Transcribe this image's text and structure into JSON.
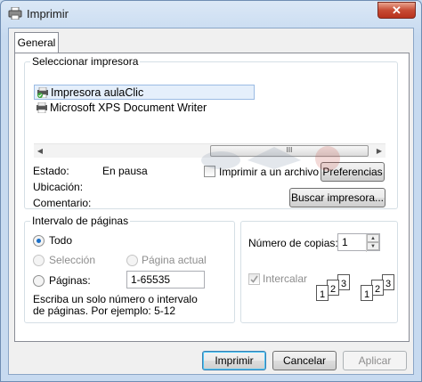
{
  "window": {
    "title": "Imprimir",
    "close_label": "✕"
  },
  "tabs": [
    {
      "label": "General"
    }
  ],
  "printer_group": {
    "legend": "Seleccionar impresora",
    "printers": [
      {
        "name": "Impresora aulaClic",
        "selected": true,
        "default": true
      },
      {
        "name": "Microsoft XPS Document Writer",
        "selected": false,
        "default": false
      }
    ],
    "scroll_thumb_glyph": "III",
    "status_label": "Estado:",
    "status_value": "En pausa",
    "location_label": "Ubicación:",
    "location_value": "",
    "comment_label": "Comentario:",
    "comment_value": "",
    "print_to_file_label": "Imprimir a un archivo",
    "print_to_file_checked": false,
    "preferences_label": "Preferencias",
    "find_printer_label": "Buscar impresora..."
  },
  "range_group": {
    "legend": "Intervalo de páginas",
    "all_label": "Todo",
    "selection_label": "Selección",
    "current_page_label": "Página actual",
    "pages_label": "Páginas:",
    "pages_value": "1-65535",
    "selected_option": "all",
    "hint": "Escriba un solo número o intervalo de páginas. Por ejemplo: 5-12"
  },
  "copies_group": {
    "copies_label": "Número de copias:",
    "copies_value": "1",
    "collate_label": "Intercalar",
    "collate_checked": true,
    "collate_icon": [
      [
        "1",
        "2",
        "3"
      ],
      [
        "1",
        "2",
        "3"
      ]
    ]
  },
  "buttons": {
    "print_label": "Imprimir",
    "cancel_label": "Cancelar",
    "apply_label": "Aplicar"
  },
  "colors": {
    "accent": "#3c7fb1",
    "selection": "#e5effb",
    "close": "#c74b34"
  }
}
